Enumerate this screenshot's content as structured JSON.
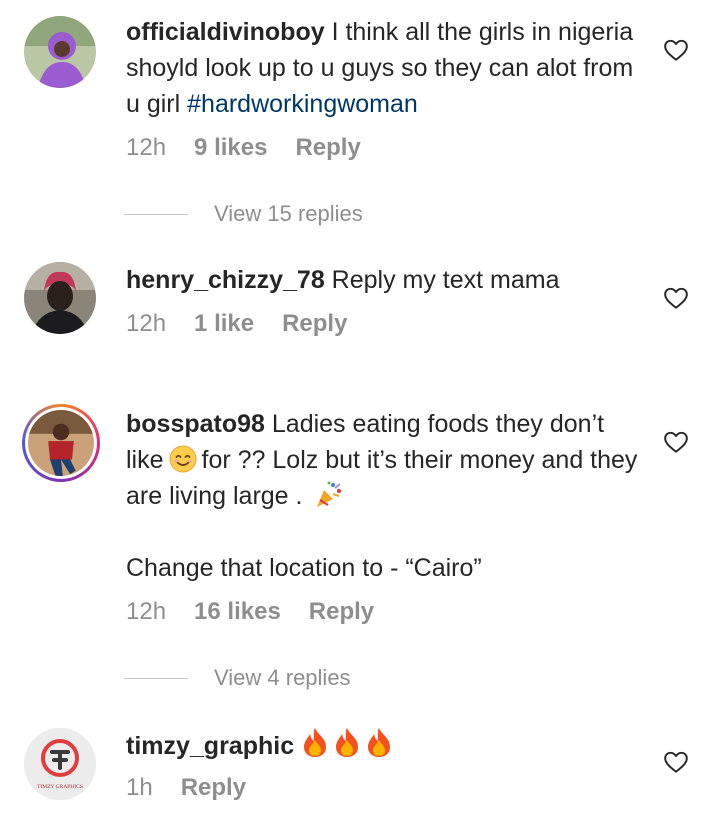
{
  "comments": [
    {
      "username": "officialdivinoboy",
      "text": " I think all the girls in nigeria shoyld look up to u guys so they can alot from u girl ",
      "hashtag": "#hardworkingwoman",
      "time": "12h",
      "likes": "9 likes",
      "reply": "Reply",
      "view_replies": "View 15 replies"
    },
    {
      "username": "henry_chizzy_78",
      "text": " Reply my text mama",
      "time": "12h",
      "likes": "1 like",
      "reply": "Reply"
    },
    {
      "username": "bosspato98",
      "text_part1": " Ladies eating foods they don’t like",
      "text_part2": "for ?? Lolz but it’s their money and they are living large .",
      "text_line2": "Change that location to - “Cairo”",
      "time": "12h",
      "likes": "16 likes",
      "reply": "Reply",
      "view_replies": "View 4 replies"
    },
    {
      "username": "timzy_graphic",
      "time": "1h",
      "reply": "Reply",
      "avatar_text": "TIMZY GRAPHICS"
    }
  ],
  "colors": {
    "text": "#262626",
    "muted": "#8e8e8e",
    "hashtag": "#00376b"
  },
  "icons": {
    "like": "heart-outline-icon",
    "emoji_smile": "smiling-face-emoji",
    "emoji_party": "party-popper-emoji",
    "emoji_fire": "fire-emoji"
  }
}
